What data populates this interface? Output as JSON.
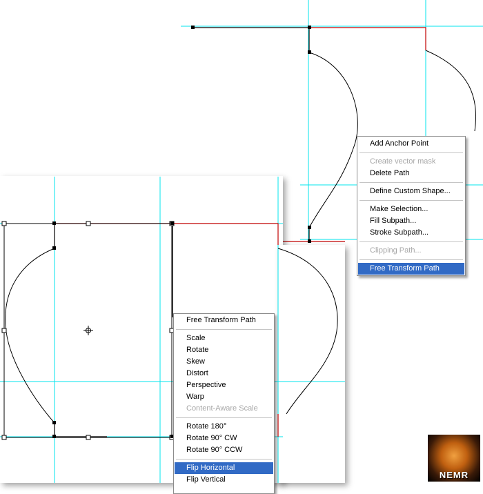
{
  "colors": {
    "guide": "#00e5ee",
    "path_red": "#c00000",
    "menu_highlight": "#316ac5",
    "disabled_text": "#a7a7a7"
  },
  "context_menu_path": {
    "items": [
      {
        "label": "Add Anchor Point",
        "enabled": true
      },
      {
        "separator": true
      },
      {
        "label": "Create vector mask",
        "enabled": false
      },
      {
        "label": "Delete Path",
        "enabled": true
      },
      {
        "separator": true
      },
      {
        "label": "Define Custom Shape...",
        "enabled": true
      },
      {
        "separator": true
      },
      {
        "label": "Make Selection...",
        "enabled": true
      },
      {
        "label": "Fill Subpath...",
        "enabled": true
      },
      {
        "label": "Stroke Subpath...",
        "enabled": true
      },
      {
        "separator": true
      },
      {
        "label": "Clipping Path...",
        "enabled": false
      },
      {
        "separator": true
      },
      {
        "label": "Free Transform Path",
        "enabled": true,
        "selected": true
      }
    ]
  },
  "context_menu_transform": {
    "items": [
      {
        "label": "Free Transform Path",
        "enabled": true
      },
      {
        "separator": true
      },
      {
        "label": "Scale",
        "enabled": true
      },
      {
        "label": "Rotate",
        "enabled": true
      },
      {
        "label": "Skew",
        "enabled": true
      },
      {
        "label": "Distort",
        "enabled": true
      },
      {
        "label": "Perspective",
        "enabled": true
      },
      {
        "label": "Warp",
        "enabled": true
      },
      {
        "label": "Content-Aware Scale",
        "enabled": false
      },
      {
        "separator": true
      },
      {
        "label": "Rotate 180°",
        "enabled": true
      },
      {
        "label": "Rotate 90° CW",
        "enabled": true
      },
      {
        "label": "Rotate 90° CCW",
        "enabled": true
      },
      {
        "separator": true
      },
      {
        "label": "Flip Horizontal",
        "enabled": true,
        "selected": true
      },
      {
        "label": "Flip Vertical",
        "enabled": true
      }
    ]
  },
  "logo": {
    "text": "NEMR",
    "icon": "tiger-logo-icon"
  }
}
